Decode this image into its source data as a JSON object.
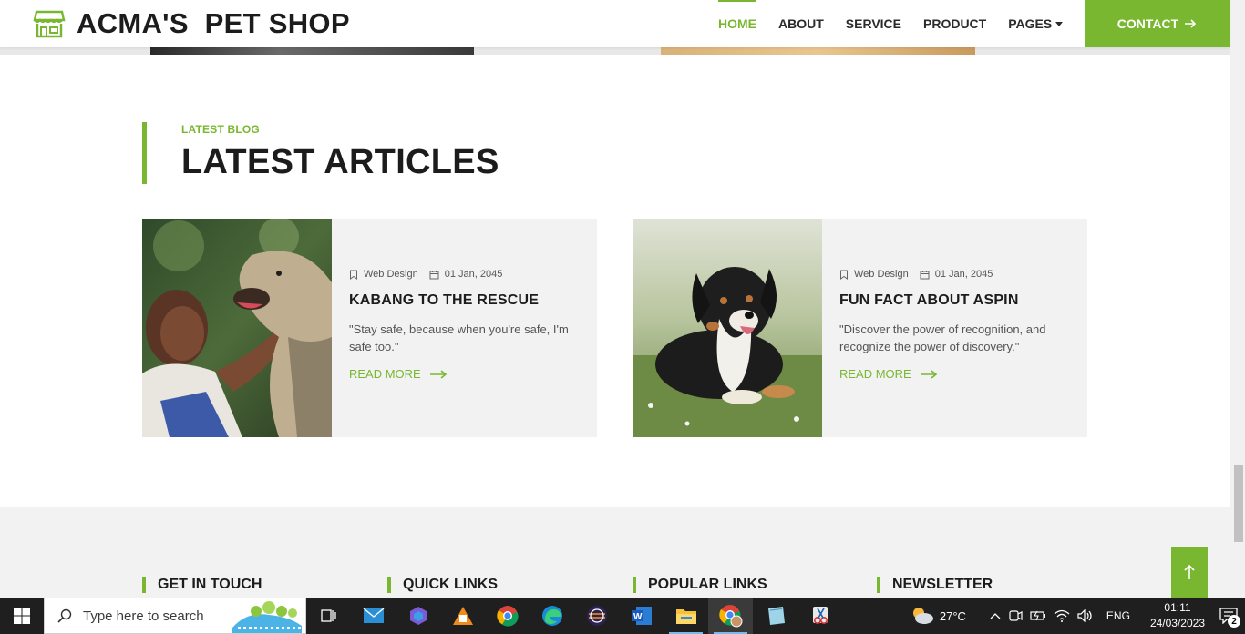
{
  "brand": {
    "name": "ACMA'S  PET SHOP",
    "icon": "shop-icon"
  },
  "nav": {
    "items": [
      {
        "label": "HOME",
        "active": true
      },
      {
        "label": "ABOUT",
        "active": false
      },
      {
        "label": "SERVICE",
        "active": false
      },
      {
        "label": "PRODUCT",
        "active": false
      },
      {
        "label": "PAGES",
        "active": false,
        "dropdown": true
      }
    ],
    "contact_label": "CONTACT"
  },
  "blog": {
    "eyebrow": "LATEST BLOG",
    "title": "LATEST ARTICLES",
    "articles": [
      {
        "category": "Web Design",
        "date": "01 Jan, 2045",
        "title": "KABANG TO THE RESCUE",
        "excerpt": "\"Stay safe, because when you're safe, I'm safe too.\"",
        "read_more": "READ MORE",
        "image": "child-with-dog-photo"
      },
      {
        "category": "Web Design",
        "date": "01 Jan, 2045",
        "title": "FUN FACT ABOUT ASPIN",
        "excerpt": "\"Discover the power of recognition, and recognize the power of discovery.\"",
        "read_more": "READ MORE",
        "image": "dog-on-grass-photo"
      }
    ]
  },
  "footer": {
    "headings": [
      "GET IN TOUCH",
      "QUICK LINKS",
      "POPULAR LINKS",
      "NEWSLETTER"
    ]
  },
  "taskbar": {
    "search_placeholder": "Type here to search",
    "weather": "27°C",
    "language": "ENG",
    "time": "01:11",
    "date": "24/03/2023",
    "notifications": "2"
  },
  "colors": {
    "accent": "#7ab730",
    "heading": "#1c1c1c",
    "card_bg": "#f2f2f2"
  }
}
